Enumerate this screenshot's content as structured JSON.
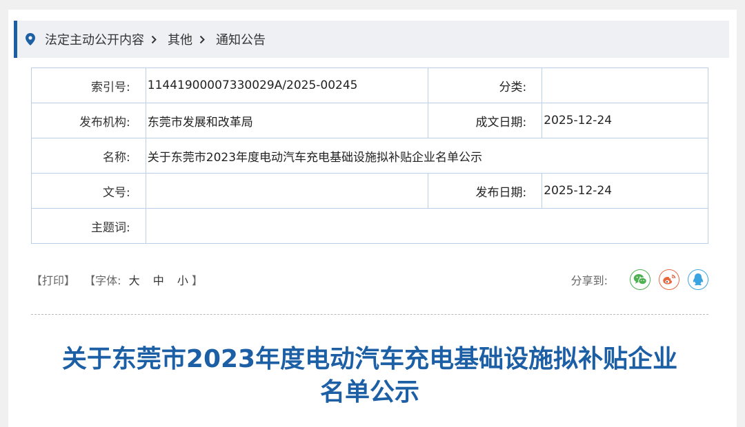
{
  "breadcrumb": {
    "items": [
      "法定主动公开内容",
      "其他",
      "通知公告"
    ]
  },
  "meta": {
    "index_label": "索引号:",
    "index_value": "11441900007330029A/2025-00245",
    "category_label": "分类:",
    "category_value": "",
    "publisher_label": "发布机构:",
    "publisher_value": "东莞市发展和改革局",
    "written_date_label": "成文日期:",
    "written_date_value": "2025-12-24",
    "name_label": "名称:",
    "name_value": "关于东莞市2023年度电动汽车充电基础设施拟补贴企业名单公示",
    "doc_no_label": "文号:",
    "doc_no_value": "",
    "publish_date_label": "发布日期:",
    "publish_date_value": "2025-12-24",
    "keywords_label": "主题词:",
    "keywords_value": ""
  },
  "tools": {
    "print": "【打印】",
    "font_prefix": "【字体:",
    "font_large": "大",
    "font_medium": "中",
    "font_small": "小",
    "font_suffix": "】",
    "share_label": "分享到:"
  },
  "icons": {
    "location": "location-pin-icon",
    "chevron": "chevron-right-icon",
    "wechat": "wechat-icon",
    "weibo": "weibo-icon",
    "qq": "qq-icon"
  },
  "colors": {
    "accent": "#1d5fa5",
    "table_border": "#b9d0e8",
    "wechat": "#4cb050",
    "weibo": "#e8683e",
    "qq": "#3aa4e0"
  },
  "article": {
    "title_line1": "关于东莞市2023年度电动汽车充电基础设施拟补贴企业",
    "title_line2": "名单公示"
  }
}
